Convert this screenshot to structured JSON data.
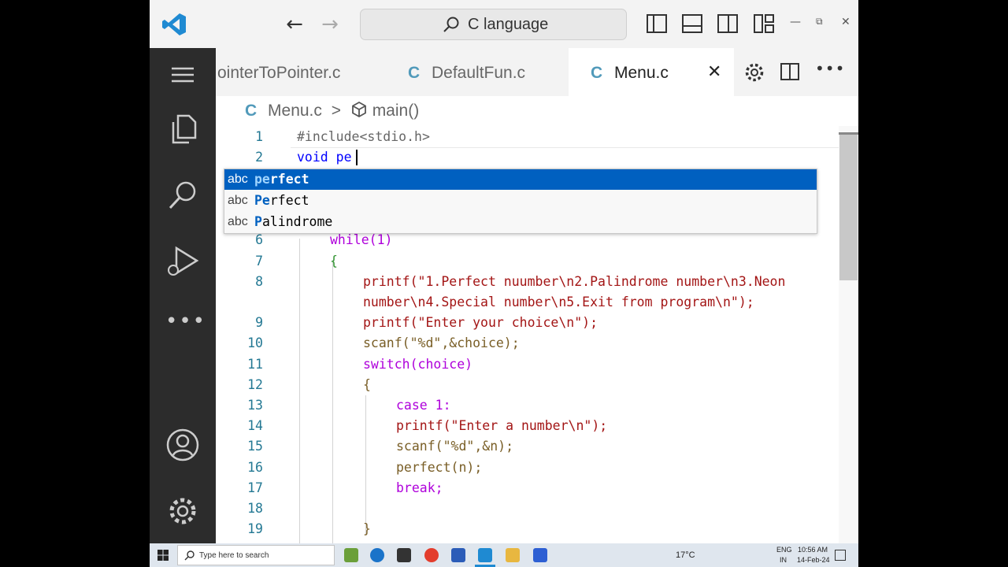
{
  "window": {
    "command_center_text": "C language",
    "colors": {
      "accent": "#0060c0",
      "activity_bg": "#2c2c2c",
      "titlebar_bg": "#f3f3f3"
    }
  },
  "tabs": [
    {
      "label": "ointerToPointer.c",
      "icon": "c-file-icon",
      "active": false
    },
    {
      "label": "DefaultFun.c",
      "icon": "c-file-icon",
      "active": false
    },
    {
      "label": "Menu.c",
      "icon": "c-file-icon",
      "active": true
    }
  ],
  "tab_icon_letter": "C",
  "breadcrumb": {
    "file": "Menu.c",
    "separator": ">",
    "symbol": "main()"
  },
  "editor": {
    "lines": [
      {
        "n": "1",
        "text": "#include<stdio.h>"
      },
      {
        "n": "2",
        "text": "void pe"
      },
      {
        "n": "6",
        "text": "while(1)"
      },
      {
        "n": "7",
        "text": "{"
      },
      {
        "n": "8",
        "text": "printf(\"1.Perfect nuumber\\n2.Palindrome number\\n3.Neon"
      },
      {
        "n": "",
        "text": "number\\n4.Special number\\n5.Exit from program\\n\");"
      },
      {
        "n": "9",
        "text": "printf(\"Enter your choice\\n\");"
      },
      {
        "n": "10",
        "text": "scanf(\"%d\",&choice);"
      },
      {
        "n": "11",
        "text": "switch(choice)"
      },
      {
        "n": "12",
        "text": "{"
      },
      {
        "n": "13",
        "text": "case 1:"
      },
      {
        "n": "14",
        "text": "printf(\"Enter a number\\n\");"
      },
      {
        "n": "15",
        "text": "scanf(\"%d\",&n);"
      },
      {
        "n": "16",
        "text": "perfect(n);"
      },
      {
        "n": "17",
        "text": "break;"
      },
      {
        "n": "18",
        "text": ""
      },
      {
        "n": "19",
        "text": "}"
      }
    ]
  },
  "suggest": {
    "kind_label": "abc",
    "items": [
      {
        "match": "pe",
        "rest": "rfect",
        "selected": true
      },
      {
        "match": "Pe",
        "rest": "rfect",
        "selected": false
      },
      {
        "match": "P",
        "rest": "alindrome",
        "selected": false
      }
    ]
  },
  "taskbar": {
    "search_placeholder": "Type here to search",
    "weather": "17°C",
    "lang": "ENG",
    "region": "IN",
    "time": "10:56 AM",
    "date": "14-Feb-24"
  }
}
